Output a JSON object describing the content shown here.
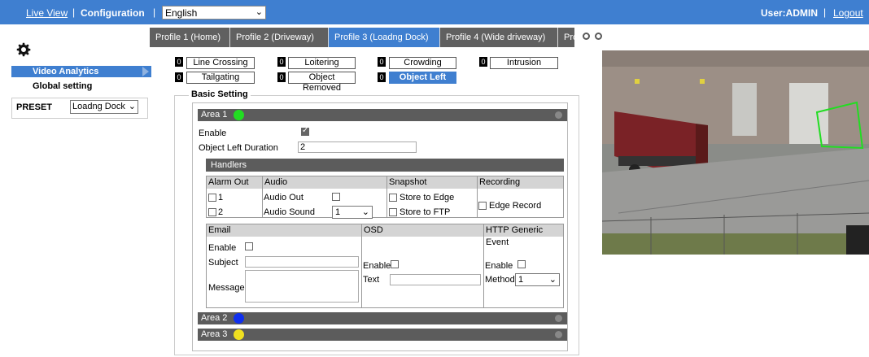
{
  "topbar": {
    "live_view": "Live View",
    "sep": "|",
    "configuration": "Configuration",
    "language": "English",
    "user": "User:ADMIN",
    "logout": "Logout",
    "bg_color": "#3f7fd0"
  },
  "sidebar": {
    "icon": "gear-icon",
    "video_analytics": "Video Analytics",
    "global_setting": "Global setting",
    "preset_label": "PRESET",
    "preset_value": "Loadng Dock"
  },
  "tabs": [
    {
      "label": "Profile 1  (Home)"
    },
    {
      "label": "Profile 2  (Driveway)"
    },
    {
      "label": "Profile 3  (Loadng Dock)",
      "active": true
    },
    {
      "label": "Profile 4  (Wide driveway)"
    },
    {
      "label": "Pro"
    }
  ],
  "rules": [
    {
      "count": "0",
      "label": "Line Crossing"
    },
    {
      "count": "0",
      "label": "Loitering"
    },
    {
      "count": "0",
      "label": "Crowding"
    },
    {
      "count": "0",
      "label": "Intrusion"
    },
    {
      "count": "0",
      "label": "Tailgating"
    },
    {
      "count": "0",
      "label": "Object Removed"
    },
    {
      "count": "0",
      "label": "Object Left",
      "active": true
    }
  ],
  "basic_setting": {
    "legend": "Basic Setting",
    "area1": {
      "label": "Area 1",
      "dot_color": "#22dd22"
    },
    "enable_label": "Enable",
    "enable_checked": true,
    "duration_label": "Object Left Duration",
    "duration_value": "2",
    "handlers": {
      "title": "Handlers",
      "alarm_out": {
        "header": "Alarm Out",
        "opt1": "1",
        "opt2": "2"
      },
      "audio": {
        "header": "Audio",
        "audio_out": "Audio Out",
        "audio_sound": "Audio Sound",
        "sound_value": "1"
      },
      "snapshot": {
        "header": "Snapshot",
        "edge": "Store to Edge",
        "ftp": "Store to FTP"
      },
      "recording": {
        "header": "Recording",
        "edge_record": "Edge Record"
      },
      "email": {
        "header": "Email",
        "enable": "Enable",
        "subject": "Subject",
        "message": "Message"
      },
      "osd": {
        "header": "OSD",
        "enable": "Enable",
        "text": "Text"
      },
      "http": {
        "header": "HTTP Generic Event",
        "enable": "Enable",
        "method": "Method",
        "method_value": "1"
      }
    },
    "area2": {
      "label": "Area 2",
      "dot_color": "#1030ee"
    },
    "area3": {
      "label": "Area 3",
      "dot_color": "#f0e020"
    }
  }
}
